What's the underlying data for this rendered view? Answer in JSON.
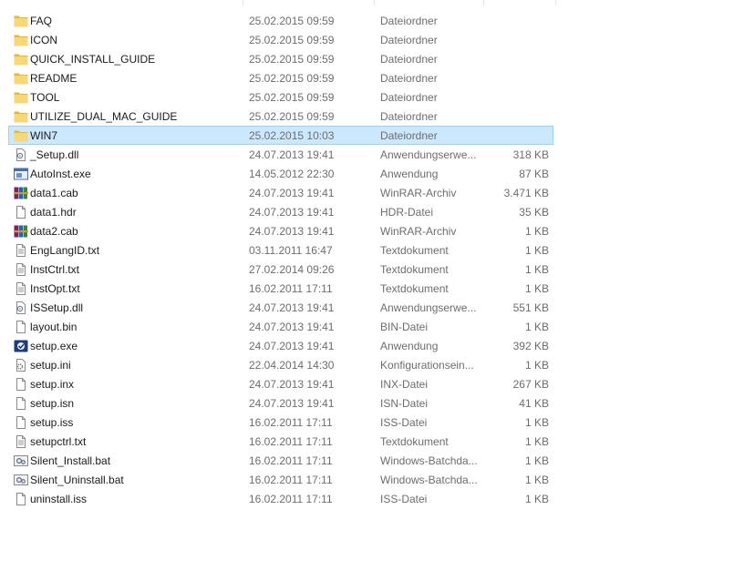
{
  "files": [
    {
      "name": "FAQ",
      "date": "25.02.2015 09:59",
      "type": "Dateiordner",
      "size": "",
      "icon": "folder",
      "selected": false
    },
    {
      "name": "ICON",
      "date": "25.02.2015 09:59",
      "type": "Dateiordner",
      "size": "",
      "icon": "folder",
      "selected": false
    },
    {
      "name": "QUICK_INSTALL_GUIDE",
      "date": "25.02.2015 09:59",
      "type": "Dateiordner",
      "size": "",
      "icon": "folder",
      "selected": false
    },
    {
      "name": "README",
      "date": "25.02.2015 09:59",
      "type": "Dateiordner",
      "size": "",
      "icon": "folder",
      "selected": false
    },
    {
      "name": "TOOL",
      "date": "25.02.2015 09:59",
      "type": "Dateiordner",
      "size": "",
      "icon": "folder",
      "selected": false
    },
    {
      "name": "UTILIZE_DUAL_MAC_GUIDE",
      "date": "25.02.2015 09:59",
      "type": "Dateiordner",
      "size": "",
      "icon": "folder",
      "selected": false
    },
    {
      "name": "WIN7",
      "date": "25.02.2015 10:03",
      "type": "Dateiordner",
      "size": "",
      "icon": "folder",
      "selected": true
    },
    {
      "name": "_Setup.dll",
      "date": "24.07.2013 19:41",
      "type": "Anwendungserwe...",
      "size": "318 KB",
      "icon": "dll",
      "selected": false
    },
    {
      "name": "AutoInst.exe",
      "date": "14.05.2012 22:30",
      "type": "Anwendung",
      "size": "87 KB",
      "icon": "exe",
      "selected": false
    },
    {
      "name": "data1.cab",
      "date": "24.07.2013 19:41",
      "type": "WinRAR-Archiv",
      "size": "3.471 KB",
      "icon": "winrar",
      "selected": false
    },
    {
      "name": "data1.hdr",
      "date": "24.07.2013 19:41",
      "type": "HDR-Datei",
      "size": "35 KB",
      "icon": "file",
      "selected": false
    },
    {
      "name": "data2.cab",
      "date": "24.07.2013 19:41",
      "type": "WinRAR-Archiv",
      "size": "1 KB",
      "icon": "winrar",
      "selected": false
    },
    {
      "name": "EngLangID.txt",
      "date": "03.11.2011 16:47",
      "type": "Textdokument",
      "size": "1 KB",
      "icon": "text",
      "selected": false
    },
    {
      "name": "InstCtrl.txt",
      "date": "27.02.2014 09:26",
      "type": "Textdokument",
      "size": "1 KB",
      "icon": "text",
      "selected": false
    },
    {
      "name": "InstOpt.txt",
      "date": "16.02.2011 17:11",
      "type": "Textdokument",
      "size": "1 KB",
      "icon": "text",
      "selected": false
    },
    {
      "name": "ISSetup.dll",
      "date": "24.07.2013 19:41",
      "type": "Anwendungserwe...",
      "size": "551 KB",
      "icon": "dll",
      "selected": false
    },
    {
      "name": "layout.bin",
      "date": "24.07.2013 19:41",
      "type": "BIN-Datei",
      "size": "1 KB",
      "icon": "file",
      "selected": false
    },
    {
      "name": "setup.exe",
      "date": "24.07.2013 19:41",
      "type": "Anwendung",
      "size": "392 KB",
      "icon": "setup",
      "selected": false
    },
    {
      "name": "setup.ini",
      "date": "22.04.2014 14:30",
      "type": "Konfigurationsein...",
      "size": "1 KB",
      "icon": "ini",
      "selected": false
    },
    {
      "name": "setup.inx",
      "date": "24.07.2013 19:41",
      "type": "INX-Datei",
      "size": "267 KB",
      "icon": "file",
      "selected": false
    },
    {
      "name": "setup.isn",
      "date": "24.07.2013 19:41",
      "type": "ISN-Datei",
      "size": "41 KB",
      "icon": "file",
      "selected": false
    },
    {
      "name": "setup.iss",
      "date": "16.02.2011 17:11",
      "type": "ISS-Datei",
      "size": "1 KB",
      "icon": "file",
      "selected": false
    },
    {
      "name": "setupctrl.txt",
      "date": "16.02.2011 17:11",
      "type": "Textdokument",
      "size": "1 KB",
      "icon": "text",
      "selected": false
    },
    {
      "name": "Silent_Install.bat",
      "date": "16.02.2011 17:11",
      "type": "Windows-Batchda...",
      "size": "1 KB",
      "icon": "bat",
      "selected": false
    },
    {
      "name": "Silent_Uninstall.bat",
      "date": "16.02.2011 17:11",
      "type": "Windows-Batchda...",
      "size": "1 KB",
      "icon": "bat",
      "selected": false
    },
    {
      "name": "uninstall.iss",
      "date": "16.02.2011 17:11",
      "type": "ISS-Datei",
      "size": "1 KB",
      "icon": "file",
      "selected": false
    }
  ],
  "colors": {
    "selection_bg": "#cce8ff",
    "selection_border": "#99d1ff",
    "folder": "#f8d775",
    "folder_dark": "#e0b64a",
    "secondary_text": "#6d6d6d"
  }
}
